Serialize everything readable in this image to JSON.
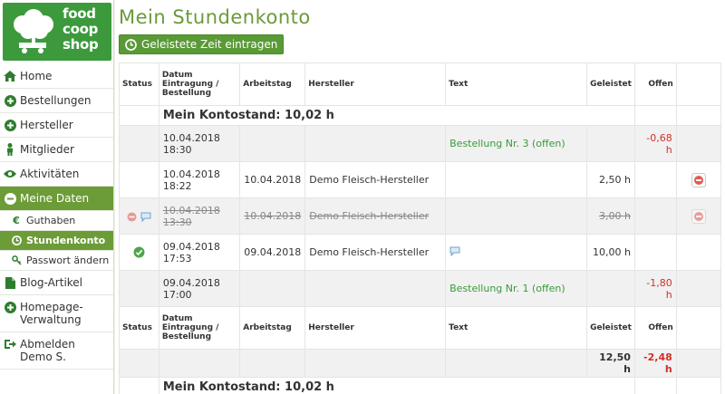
{
  "brand": {
    "logo_line1": "food",
    "logo_line2": "coop",
    "logo_line3": "shop",
    "color": "#3c9a3c"
  },
  "sidebar": {
    "items": [
      {
        "label": "Home"
      },
      {
        "label": "Bestellungen"
      },
      {
        "label": "Hersteller"
      },
      {
        "label": "Mitglieder"
      },
      {
        "label": "Aktivitäten"
      },
      {
        "label": "Meine Daten"
      },
      {
        "label": "Guthaben"
      },
      {
        "label": "Stundenkonto"
      },
      {
        "label": "Passwort ändern"
      },
      {
        "label": "Blog-Artikel"
      },
      {
        "label": "Homepage-Verwaltung"
      },
      {
        "label": "Abmelden Demo S."
      }
    ]
  },
  "main": {
    "title": "Mein Stundenkonto",
    "button_label": "Geleistete Zeit eintragen",
    "columns": {
      "status": "Status",
      "datum": "Datum Eintragung / Bestellung",
      "arbeitstag": "Arbeitstag",
      "hersteller": "Hersteller",
      "text": "Text",
      "geleistet": "Geleistet",
      "offen": "Offen"
    },
    "balance": "Mein Kontostand: 10,02 h",
    "rows": [
      {
        "datum1": "10.04.2018",
        "datum2": "18:30",
        "arbeitstag": "",
        "hersteller": "",
        "text": "Bestellung Nr. 3 (offen)",
        "geleistet": "",
        "offen": "-0,68 h"
      },
      {
        "datum1": "10.04.2018",
        "datum2": "18:22",
        "arbeitstag": "10.04.2018",
        "hersteller": "Demo Fleisch-Hersteller",
        "text": "",
        "geleistet": "2,50 h",
        "offen": ""
      },
      {
        "datum1": "10.04.2018",
        "datum2": "13:30",
        "arbeitstag": "10.04.2018",
        "hersteller": "Demo Fleisch-Hersteller",
        "text": "",
        "geleistet": "3,00 h",
        "offen": ""
      },
      {
        "datum1": "09.04.2018",
        "datum2": "17:53",
        "arbeitstag": "09.04.2018",
        "hersteller": "Demo Fleisch-Hersteller",
        "text": "",
        "geleistet": "10,00 h",
        "offen": ""
      },
      {
        "datum1": "09.04.2018",
        "datum2": "17:00",
        "arbeitstag": "",
        "hersteller": "",
        "text": "Bestellung Nr. 1 (offen)",
        "geleistet": "",
        "offen": "-1,80 h"
      }
    ],
    "sum_geleistet": "12,50 h",
    "sum_offen": "-2,48 h",
    "balance_bottom": "Mein Kontostand: 10,02 h"
  }
}
